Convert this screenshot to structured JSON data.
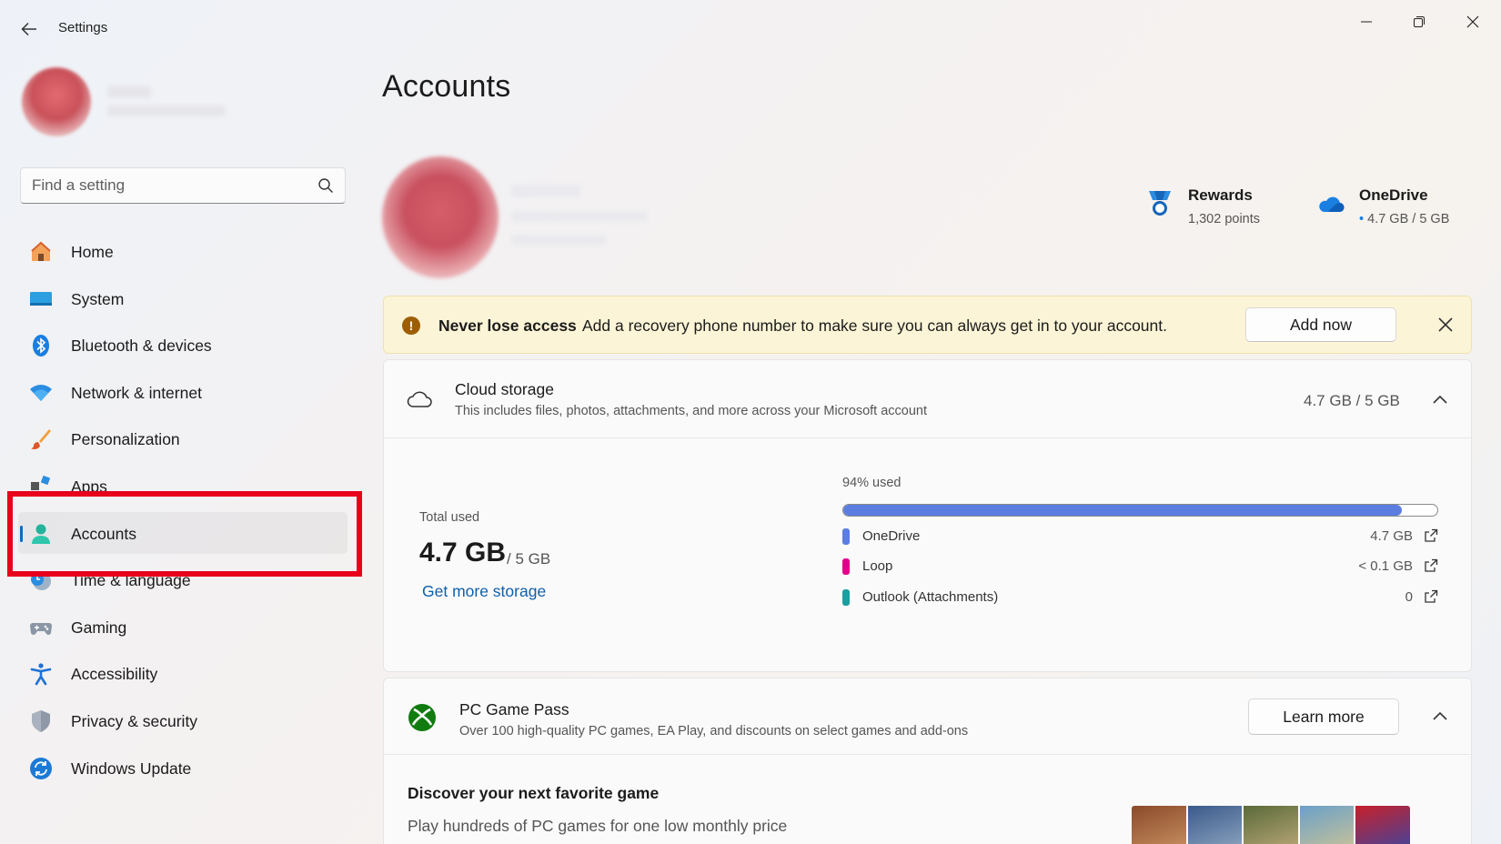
{
  "window": {
    "title": "Settings"
  },
  "search": {
    "placeholder": "Find a setting"
  },
  "sidebar": {
    "items": [
      {
        "label": "Home",
        "icon": "home-icon"
      },
      {
        "label": "System",
        "icon": "system-icon"
      },
      {
        "label": "Bluetooth & devices",
        "icon": "bluetooth-icon"
      },
      {
        "label": "Network & internet",
        "icon": "wifi-icon"
      },
      {
        "label": "Personalization",
        "icon": "brush-icon"
      },
      {
        "label": "Apps",
        "icon": "apps-icon"
      },
      {
        "label": "Accounts",
        "icon": "person-icon",
        "active": true
      },
      {
        "label": "Time & language",
        "icon": "clock-globe-icon"
      },
      {
        "label": "Gaming",
        "icon": "gamepad-icon"
      },
      {
        "label": "Accessibility",
        "icon": "accessibility-icon"
      },
      {
        "label": "Privacy & security",
        "icon": "shield-icon"
      },
      {
        "label": "Windows Update",
        "icon": "refresh-icon"
      }
    ]
  },
  "main": {
    "title": "Accounts",
    "rewards": {
      "title": "Rewards",
      "value": "1,302 points"
    },
    "onedrive": {
      "title": "OneDrive",
      "value": "4.7 GB / 5 GB"
    },
    "banner": {
      "title": "Never lose access",
      "text": "Add a recovery phone number to make sure you can always get in to your account.",
      "button": "Add now"
    },
    "cloud_storage": {
      "title": "Cloud storage",
      "subtitle": "This includes files, photos, attachments, and more across your Microsoft account",
      "summary": "4.7 GB / 5 GB",
      "total_label": "Total used",
      "total_value": "4.7 GB",
      "total_of": "/ 5 GB",
      "link": "Get more storage",
      "used_label": "94% used",
      "used_fraction": 0.94,
      "breakdown": [
        {
          "name": "OneDrive",
          "value": "4.7 GB",
          "color": "#5b7ee0"
        },
        {
          "name": "Loop",
          "value": "< 0.1 GB",
          "color": "#e3008c"
        },
        {
          "name": "Outlook (Attachments)",
          "value": "0",
          "color": "#1a9ea0"
        }
      ]
    },
    "game_pass": {
      "title": "PC Game Pass",
      "subtitle": "Over 100 high-quality PC games, EA Play, and discounts on select games and add-ons",
      "button": "Learn more",
      "discover_title": "Discover your next favorite game",
      "discover_sub": "Play hundreds of PC games for one low monthly price"
    }
  },
  "colors": {
    "accent": "#0f6cbd",
    "highlight": "#e8001c",
    "banner_bg": "#fcf4d6"
  }
}
